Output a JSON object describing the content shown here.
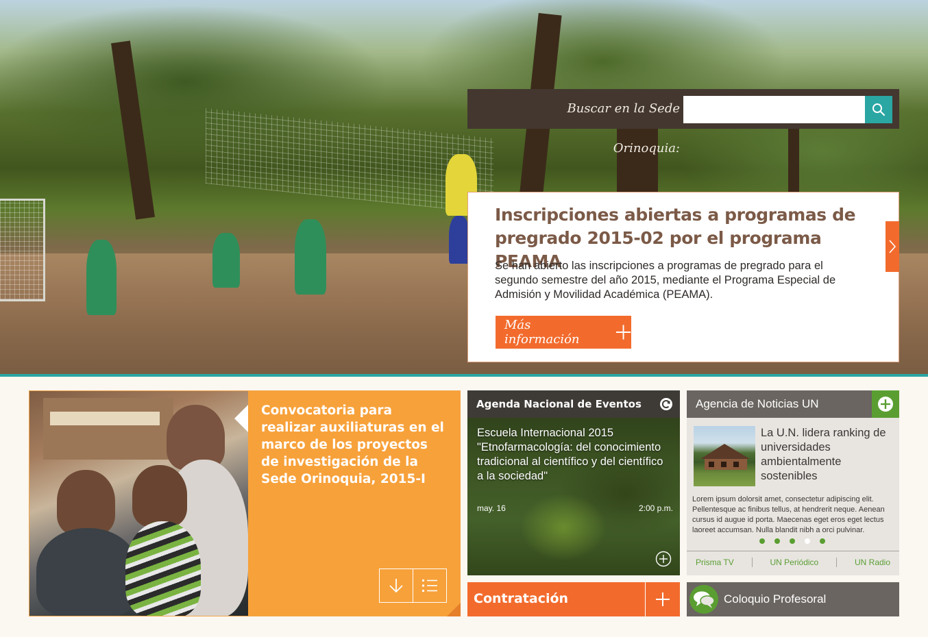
{
  "search": {
    "label": "Buscar en la Sede Orinoquia:",
    "placeholder": "",
    "value": ""
  },
  "slide": {
    "title": "Inscripciones abiertas a programas de pregrado 2015-02 por el programa PEAMA",
    "body": "Se han abierto las inscripciones a programas de pregrado para el segundo  semestre del año 2015, mediante el Programa Especial de Admisión y Movilidad Académica (PEAMA).",
    "button_label": "Más información"
  },
  "convocatoria": {
    "title": "Convocatoria para realizar auxiliaturas en el marco de los proyectos de investigación de la Sede Orinoquia, 2015-I"
  },
  "agenda": {
    "title": "Agenda Nacional de Eventos",
    "event_title": "Escuela Internacional 2015 \"Etnofarmacología: del conocimiento tradicional al científico y del científico a la sociedad\"",
    "date": "may. 16",
    "time": "2:00 p.m."
  },
  "contratacion": {
    "label": "Contratación"
  },
  "noticias": {
    "title": "Agencia de Noticias UN",
    "headline": "La U.N. lidera ranking de universidades ambientalmente sostenibles",
    "text": "Lorem ipsum dolorsit amet, consectetur adipiscing elit. Pellentesque ac finibus tellus, at hendrerit neque. Aenean cursus id augue id porta. Maecenas eget eros eget lectus laoreet accumsan. Nulla blandit nibh a orci pulvinar.",
    "dots_total": 5,
    "active_dot": 4,
    "links": [
      "Prisma TV",
      "UN Periódico",
      "UN Radio"
    ]
  },
  "coloquio": {
    "label": "Coloquio Profesoral"
  },
  "colors": {
    "orange": "#f26b2d",
    "amber": "#f7a13a",
    "teal": "#2aa6a3",
    "green": "#5a9e32",
    "dark_brown": "#43372f",
    "gray": "#6a6560"
  }
}
